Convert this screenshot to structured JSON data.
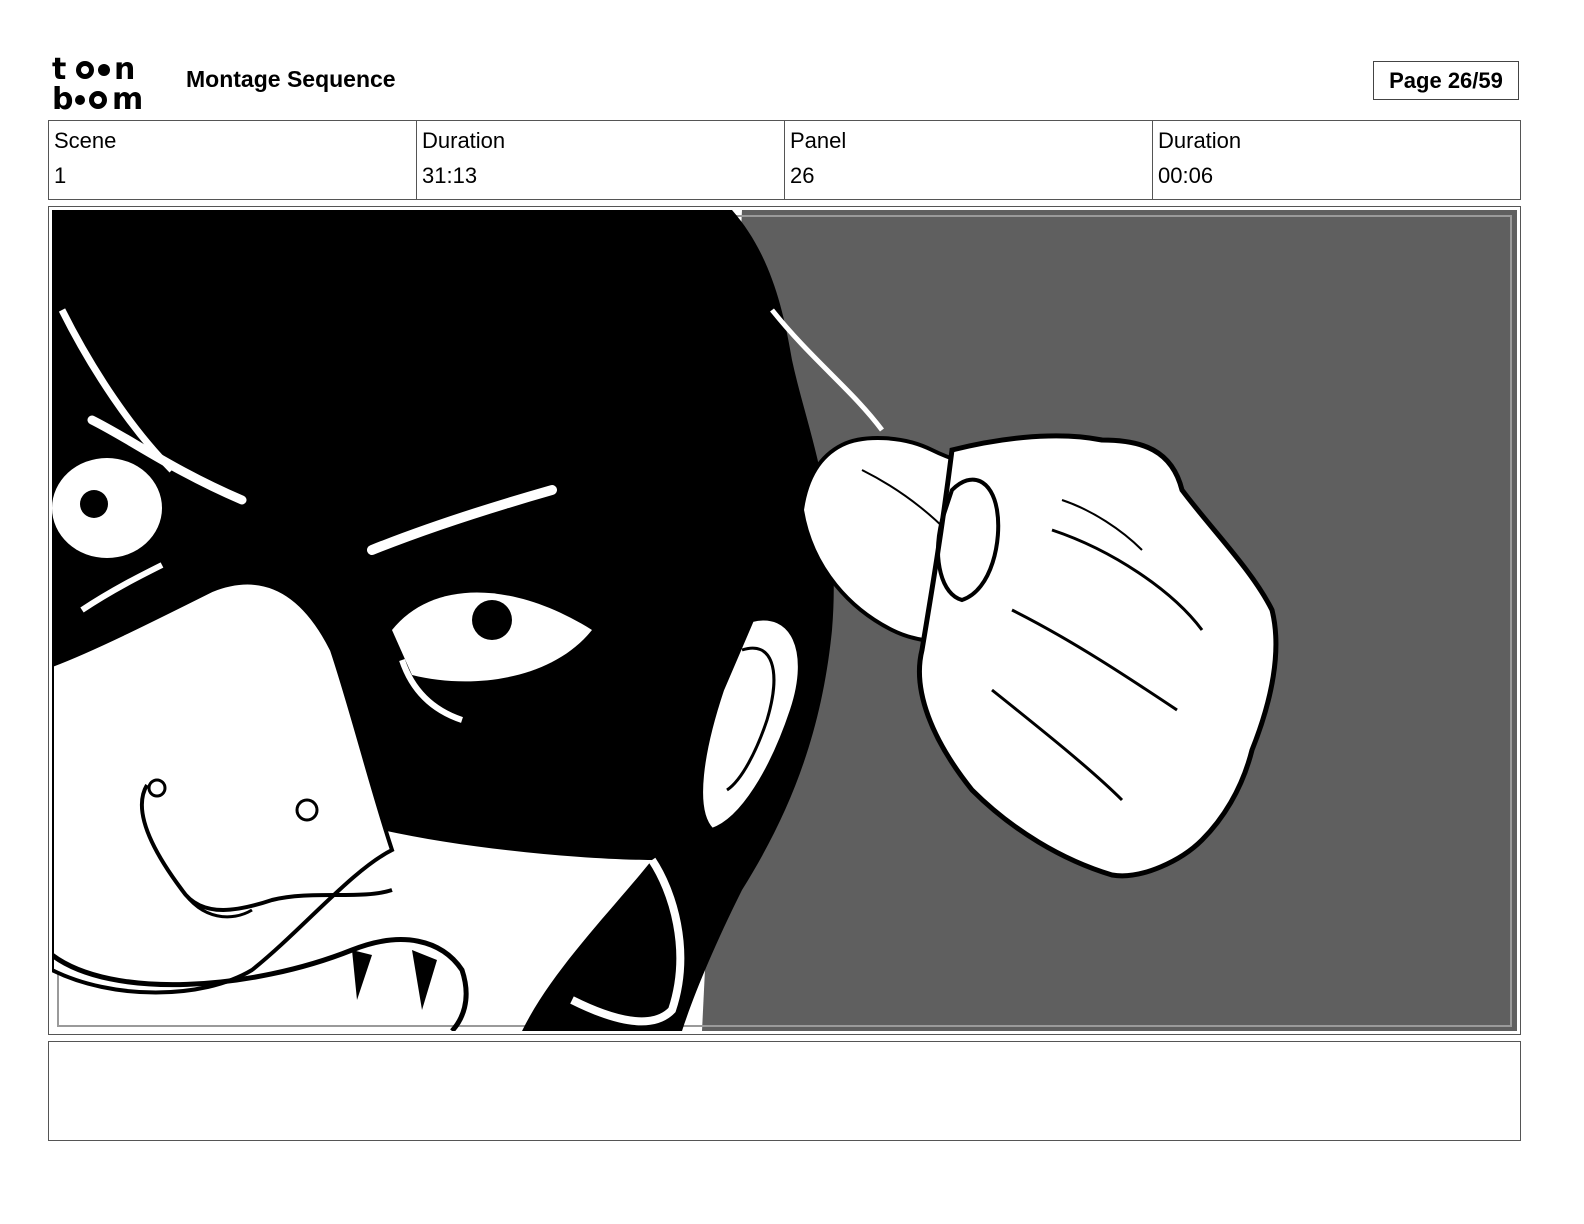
{
  "header": {
    "logo_text_top": "toon",
    "logo_text_bottom": "boom",
    "title": "Montage Sequence",
    "page_label": "Page 26/59"
  },
  "info": {
    "scene_label": "Scene",
    "scene_value": "1",
    "scene_duration_label": "Duration",
    "scene_duration_value": "31:13",
    "panel_label": "Panel",
    "panel_value": "26",
    "panel_duration_label": "Duration",
    "panel_duration_value": "00:06"
  },
  "panel": {
    "background_color": "#5f5f5f",
    "ink_color": "#000000",
    "paper_color": "#ffffff"
  },
  "notes": {
    "text": ""
  }
}
